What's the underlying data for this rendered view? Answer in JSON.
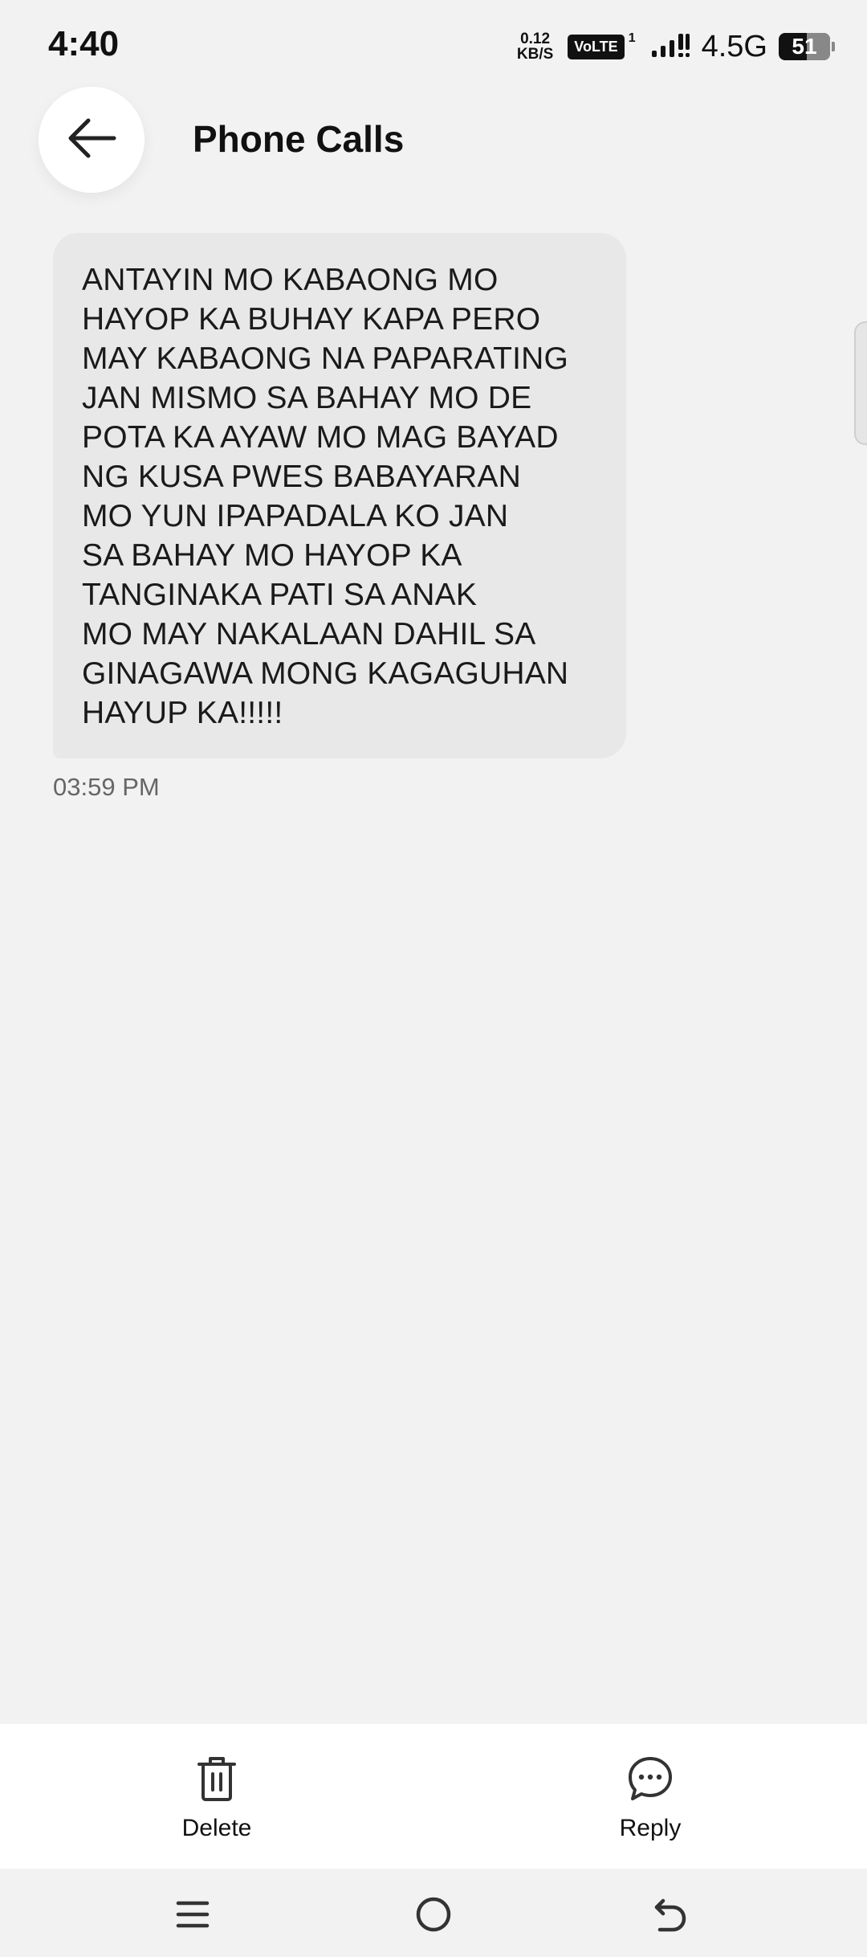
{
  "status_bar": {
    "time": "4:40",
    "netspeed_value": "0.12",
    "netspeed_unit": "KB/S",
    "volte_label": "VoLTE",
    "volte_sup": "1",
    "network_type": "4.5G",
    "battery_level": "51",
    "signal_icon": "signal-bars-icon",
    "battery_icon": "battery-icon"
  },
  "header": {
    "title": "Phone Calls",
    "back_icon": "arrow-left-icon"
  },
  "message": {
    "text": "ANTAYIN MO KABAONG MO\nHAYOP KA BUHAY KAPA PERO\nMAY KABAONG NA PAPARATING\nJAN MISMO SA BAHAY MO DE\nPOTA KA AYAW MO MAG BAYAD\nNG KUSA PWES BABAYARAN\nMO YUN IPAPADALA KO JAN\nSA BAHAY MO HAYOP KA\nTANGINAKA PATI SA ANAK\nMO MAY NAKALAAN DAHIL SA\nGINAGAWA MONG KAGAGUHAN\nHAYUP KA!!!!!",
    "time": "03:59 PM"
  },
  "actions": {
    "delete_label": "Delete",
    "delete_icon": "trash-icon",
    "reply_label": "Reply",
    "reply_icon": "chat-bubble-icon"
  },
  "nav": {
    "menu_icon": "menu-icon",
    "home_icon": "home-circle-icon",
    "back_icon": "back-arrow-icon"
  }
}
